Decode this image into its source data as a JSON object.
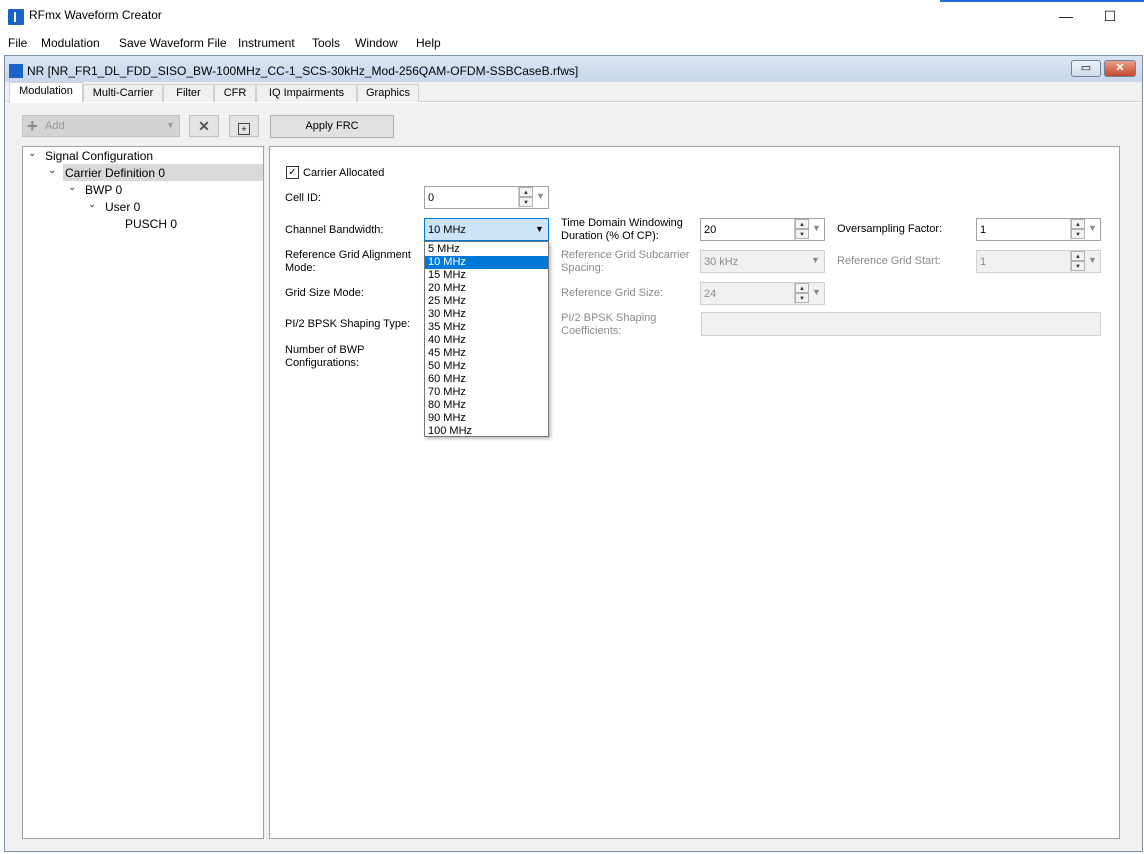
{
  "app": {
    "title": "RFmx Waveform Creator",
    "minimize_glyph": "—",
    "maximize_glyph": "☐",
    "accent_color": "#1e6fd9"
  },
  "menu": [
    "File",
    "Modulation",
    "Save Waveform File",
    "Instrument",
    "Tools",
    "Window",
    "Help"
  ],
  "document": {
    "title": "NR [NR_FR1_DL_FDD_SISO_BW-100MHz_CC-1_SCS-30kHz_Mod-256QAM-OFDM-SSBCaseB.rfws]",
    "restore_glyph": "▭",
    "close_glyph": "✕"
  },
  "tabs": [
    "Modulation",
    "Multi-Carrier",
    "Filter",
    "CFR",
    "IQ Impairments",
    "Graphics"
  ],
  "active_tab": "Modulation",
  "toolbar": {
    "add_label": "Add",
    "add_icon": "plus-icon",
    "delete_glyph": "✕",
    "duplicate_glyph": "+",
    "apply_frc_label": "Apply FRC"
  },
  "tree": {
    "root": "Signal Configuration",
    "carrier": "Carrier Definition 0",
    "bwp": "BWP 0",
    "user": "User 0",
    "pusch": "PUSCH 0",
    "expand_glyph": "⌄"
  },
  "form": {
    "carrier_allocated": {
      "label": "Carrier Allocated",
      "checked": true,
      "check_glyph": "✓"
    },
    "cell_id": {
      "label": "Cell ID:",
      "value": "0"
    },
    "channel_bandwidth": {
      "label": "Channel Bandwidth:",
      "value": "10 MHz",
      "options": [
        "5 MHz",
        "10 MHz",
        "15 MHz",
        "20 MHz",
        "25 MHz",
        "30 MHz",
        "35 MHz",
        "40 MHz",
        "45 MHz",
        "50 MHz",
        "60 MHz",
        "70 MHz",
        "80 MHz",
        "90 MHz",
        "100 MHz"
      ],
      "highlighted_index": 1
    },
    "ref_grid_alignment_mode": {
      "label_line1": "Reference Grid Alignment",
      "label_line2": "Mode:"
    },
    "grid_size_mode": {
      "label": "Grid Size Mode:"
    },
    "pi2_bpsk_shaping_type": {
      "label": "PI/2 BPSK Shaping Type:"
    },
    "num_bwp_configs": {
      "label_line1": "Number of BWP",
      "label_line2": "Configurations:"
    },
    "time_domain_windowing": {
      "label_line1": "Time Domain Windowing",
      "label_line2": "Duration (% Of CP):",
      "value": "20"
    },
    "ref_grid_subcarrier_spacing": {
      "label_line1": "Reference Grid Subcarrier",
      "label_line2": "Spacing:",
      "value": "30 kHz"
    },
    "ref_grid_size": {
      "label": "Reference Grid Size:",
      "value": "24"
    },
    "pi2_bpsk_shaping_coefficients": {
      "label_line1": "PI/2 BPSK Shaping",
      "label_line2": "Coefficients:",
      "value": ""
    },
    "oversampling_factor": {
      "label": "Oversampling Factor:",
      "value": "1"
    },
    "ref_grid_start": {
      "label": "Reference Grid Start:",
      "value": "1"
    }
  },
  "glyphs": {
    "spin_up": "▲",
    "spin_down": "▼",
    "dropdown": "▼"
  }
}
